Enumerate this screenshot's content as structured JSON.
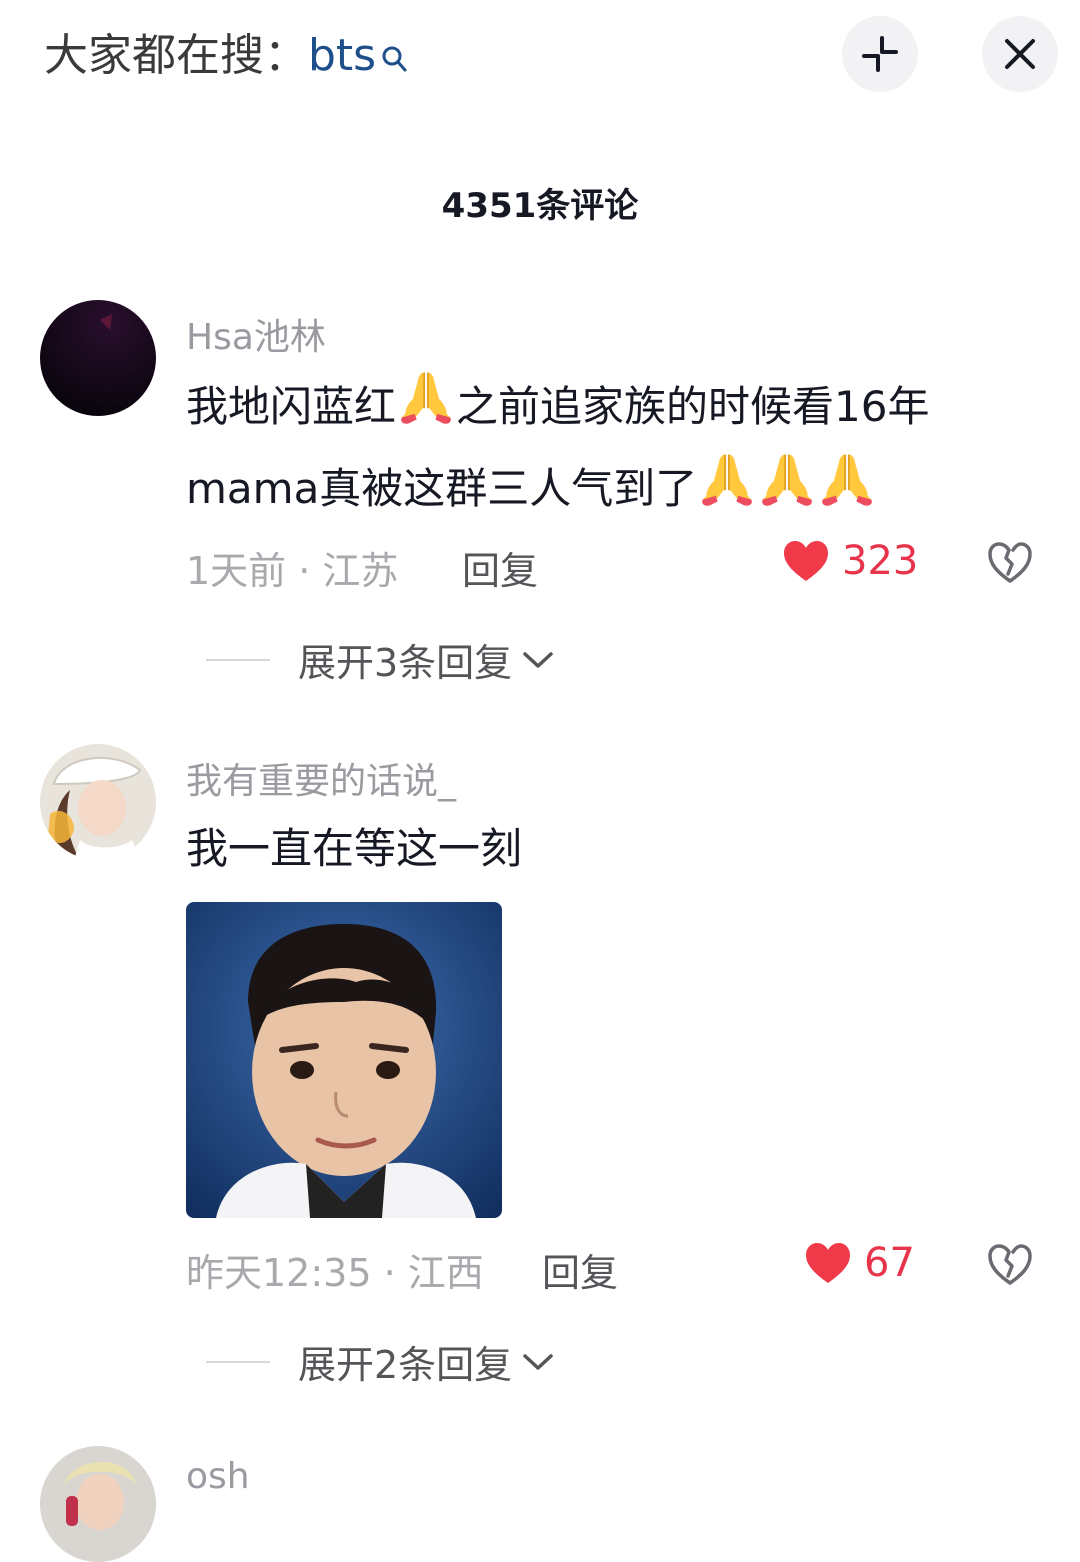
{
  "header": {
    "search_label": "大家都在搜：",
    "search_keyword": "bts"
  },
  "comment_count": "4351条评论",
  "comments": [
    {
      "username": "Hsa池林",
      "text_line1_a": "我地闪蓝红",
      "text_line1_b": "之前追家族的时候看16年",
      "text_line2": "mama真被这群三人气到了",
      "meta": "1天前 · 江苏",
      "reply_label": "回复",
      "likes": "323",
      "expand_label": "展开3条回复"
    },
    {
      "username": "我有重要的话说_",
      "text": "我一直在等这一刻",
      "meta": "昨天12:35 · 江西",
      "reply_label": "回复",
      "likes": "67",
      "expand_label": "展开2条回复"
    },
    {
      "username": "osh"
    }
  ],
  "colors": {
    "accent_like": "#e8344a",
    "keyword": "#1f4f8a"
  },
  "icons": [
    "search-icon",
    "collapse-icon",
    "close-icon",
    "heart-icon",
    "dislike-icon",
    "chevron-down-icon",
    "folded-hands-emoji"
  ]
}
